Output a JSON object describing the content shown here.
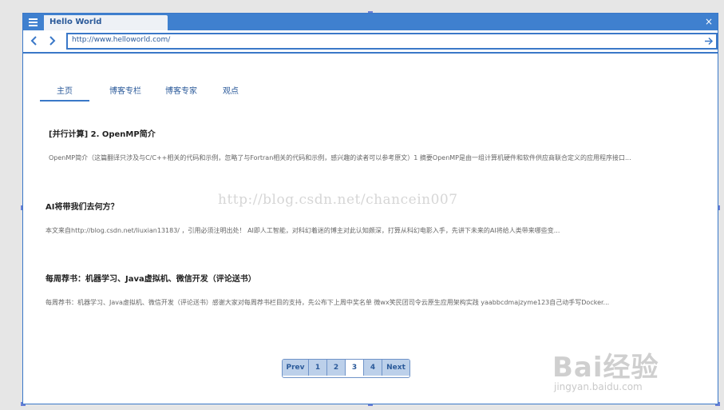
{
  "window": {
    "tab_title": "Hello World",
    "close_glyph": "×",
    "url": "http://www.helloworld.com/"
  },
  "site_tabs": [
    {
      "label": "主页",
      "active": true
    },
    {
      "label": "博客专栏",
      "active": false
    },
    {
      "label": "博客专家",
      "active": false
    },
    {
      "label": "观点",
      "active": false
    }
  ],
  "articles": [
    {
      "title": "[并行计算] 2. OpenMP简介",
      "summary": "OpenMP简介（这篇翻译只涉及与C/C++相关的代码和示例，忽略了与Fortran相关的代码和示例，感兴趣的读者可以参考原文）1 摘要OpenMP是由一组计算机硬件和软件供应商联合定义的应用程序接口..."
    },
    {
      "title": "AI将带我们去何方？",
      "summary": "本文来自http://blog.csdn.net/liuxian13183/ ，引用必须注明出处！ AI即人工智能，对科幻着迷的博主对此认知颇深，打算从科幻电影入手，先讲下未来的AI将给人类带来哪些变..."
    },
    {
      "title": "每周荐书：机器学习、Java虚拟机、微信开发（评论送书）",
      "summary": "每周荐书：机器学习、Java虚拟机、微信开发（评论送书）感谢大家对每周荐书栏目的支持，先公布下上周中奖名单 微wx笑民团司令云原生应用架构实践 yaabbcdmajzyme123自己动手写Docker..."
    }
  ],
  "watermark": "http://blog.csdn.net/chancein007",
  "pagination": {
    "prev": "Prev",
    "pages": [
      "1",
      "2",
      "3",
      "4"
    ],
    "active_page": "3",
    "next": "Next"
  },
  "baidu_watermark": {
    "logo": "Bai经验",
    "url": "jingyan.baidu.com"
  },
  "colors": {
    "accent": "#3f80cf",
    "pager_bg": "#bcd0ea"
  },
  "icons": [
    "menu-icon",
    "back-arrow-icon",
    "forward-arrow-icon",
    "go-arrow-icon",
    "close-icon"
  ]
}
